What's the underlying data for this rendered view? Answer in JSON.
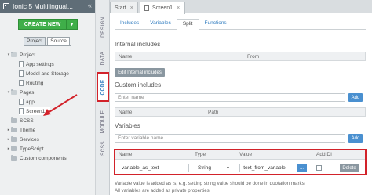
{
  "project": {
    "title": "Ionic 5 Multilingual...",
    "collapse_icon": "double-chevron-left",
    "create_label": "CREATE NEW",
    "tabs": [
      "Project",
      "Source"
    ],
    "tree": [
      {
        "label": "Project"
      },
      {
        "label": "App settings"
      },
      {
        "label": "Model and Storage"
      },
      {
        "label": "Routing"
      },
      {
        "label": "Pages"
      },
      {
        "label": "app"
      },
      {
        "label": "Screen1"
      },
      {
        "label": "SCSS"
      },
      {
        "label": "Theme"
      },
      {
        "label": "Services"
      },
      {
        "label": "TypeScript"
      },
      {
        "label": "Custom components"
      }
    ]
  },
  "side_tabs": [
    "DESIGN",
    "DATA",
    "CODE",
    "MODULE",
    "SCSS"
  ],
  "doc_tabs": {
    "start": "Start",
    "screen": "Screen1",
    "close": "×"
  },
  "subtabs": [
    "Includes",
    "Variables",
    "Split",
    "Functions"
  ],
  "internal": {
    "heading": "Internal includes",
    "col_name": "Name",
    "col_from": "From",
    "edit_button": "Edit Internal includes"
  },
  "custom": {
    "heading": "Custom includes",
    "placeholder": "Enter name",
    "add_label": "Add",
    "col_name": "Name",
    "col_path": "Path"
  },
  "variables": {
    "heading": "Variables",
    "placeholder": "Enter variable name",
    "add_label": "Add",
    "col_name": "Name",
    "col_type": "Type",
    "col_value": "Value",
    "col_adddi": "Add DI",
    "row": {
      "name": "variable_as_text",
      "type": "String",
      "value": "'text_from_variable'",
      "more": "...",
      "delete": "Delete"
    },
    "note1": "Variable value is added as is, e.g. setting string value should be done in quotation marks.",
    "note2": "All variables are added as  private  properties"
  },
  "colors": {
    "accent_red": "#d2222a",
    "create_green": "#3fae49",
    "link_blue": "#2e7bbf"
  }
}
